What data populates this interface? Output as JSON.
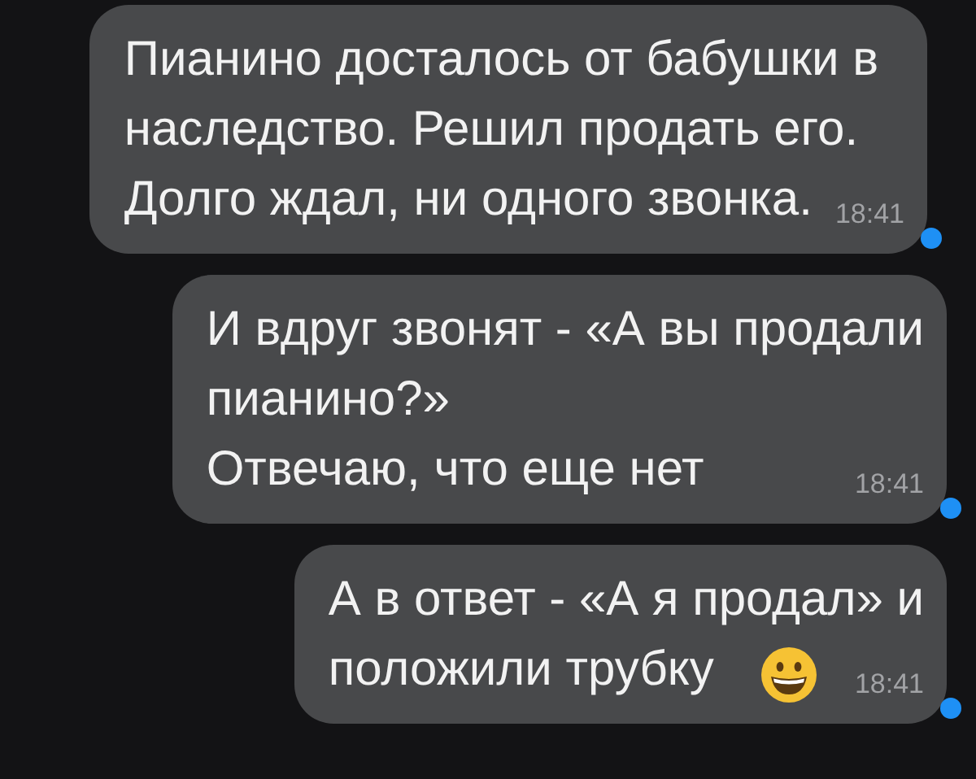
{
  "messages": [
    {
      "lines": [
        "Пианино досталось от бабушки в",
        "наследство. Решил продать его.",
        "Долго ждал, ни одного звонка."
      ],
      "emoji": false,
      "time": "18:41",
      "unread": true
    },
    {
      "lines": [
        "И вдруг звонят - «А вы продали",
        "пианино?»",
        "Отвечаю, что еще нет"
      ],
      "emoji": false,
      "time": "18:41",
      "unread": true
    },
    {
      "lines": [
        "А в ответ - «А я продал» и",
        "положили трубку"
      ],
      "emoji": true,
      "time": "18:41",
      "unread": true
    }
  ]
}
